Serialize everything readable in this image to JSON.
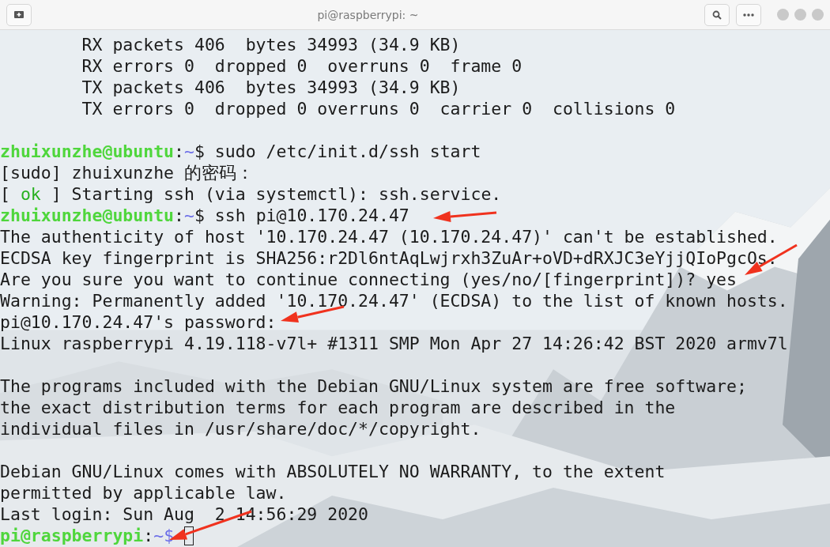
{
  "window": {
    "title": "pi@raspberrypi: ~"
  },
  "terminal": {
    "lines": [
      {
        "kind": "text",
        "segments": [
          {
            "kind": "plain",
            "text": "        RX packets 406  bytes 34993 (34.9 KB)"
          }
        ]
      },
      {
        "kind": "text",
        "segments": [
          {
            "kind": "plain",
            "text": "        RX errors 0  dropped 0  overruns 0  frame 0"
          }
        ]
      },
      {
        "kind": "text",
        "segments": [
          {
            "kind": "plain",
            "text": "        TX packets 406  bytes 34993 (34.9 KB)"
          }
        ]
      },
      {
        "kind": "text",
        "segments": [
          {
            "kind": "plain",
            "text": "        TX errors 0  dropped 0 overruns 0  carrier 0  collisions 0"
          }
        ]
      },
      {
        "kind": "blank"
      },
      {
        "kind": "text",
        "segments": [
          {
            "kind": "user",
            "text": "zhuixunzhe@ubuntu"
          },
          {
            "kind": "plain",
            "text": ":"
          },
          {
            "kind": "path",
            "text": "~"
          },
          {
            "kind": "plain",
            "text": "$ sudo /etc/init.d/ssh start"
          }
        ]
      },
      {
        "kind": "text",
        "segments": [
          {
            "kind": "plain",
            "text": "[sudo] zhuixunzhe 的密码："
          }
        ]
      },
      {
        "kind": "text",
        "segments": [
          {
            "kind": "plain",
            "text": "[ "
          },
          {
            "kind": "ok",
            "text": "ok"
          },
          {
            "kind": "plain",
            "text": " ] Starting ssh (via systemctl): ssh.service."
          }
        ]
      },
      {
        "kind": "text",
        "segments": [
          {
            "kind": "user",
            "text": "zhuixunzhe@ubuntu"
          },
          {
            "kind": "plain",
            "text": ":"
          },
          {
            "kind": "path",
            "text": "~"
          },
          {
            "kind": "plain",
            "text": "$ ssh pi@10.170.24.47"
          }
        ]
      },
      {
        "kind": "text",
        "segments": [
          {
            "kind": "plain",
            "text": "The authenticity of host '10.170.24.47 (10.170.24.47)' can't be established."
          }
        ]
      },
      {
        "kind": "text",
        "segments": [
          {
            "kind": "plain",
            "text": "ECDSA key fingerprint is SHA256:r2Dl6ntAqLwjrxh3ZuAr+oVD+dRXJC3eYjjQIoPgcOs."
          }
        ]
      },
      {
        "kind": "text",
        "segments": [
          {
            "kind": "plain",
            "text": "Are you sure you want to continue connecting (yes/no/[fingerprint])? yes"
          }
        ]
      },
      {
        "kind": "text",
        "segments": [
          {
            "kind": "plain",
            "text": "Warning: Permanently added '10.170.24.47' (ECDSA) to the list of known hosts."
          }
        ]
      },
      {
        "kind": "text",
        "segments": [
          {
            "kind": "plain",
            "text": "pi@10.170.24.47's password:"
          }
        ]
      },
      {
        "kind": "text",
        "segments": [
          {
            "kind": "plain",
            "text": "Linux raspberrypi 4.19.118-v7l+ #1311 SMP Mon Apr 27 14:26:42 BST 2020 armv7l"
          }
        ]
      },
      {
        "kind": "blank"
      },
      {
        "kind": "text",
        "segments": [
          {
            "kind": "plain",
            "text": "The programs included with the Debian GNU/Linux system are free software;"
          }
        ]
      },
      {
        "kind": "text",
        "segments": [
          {
            "kind": "plain",
            "text": "the exact distribution terms for each program are described in the"
          }
        ]
      },
      {
        "kind": "text",
        "segments": [
          {
            "kind": "plain",
            "text": "individual files in /usr/share/doc/*/copyright."
          }
        ]
      },
      {
        "kind": "blank"
      },
      {
        "kind": "text",
        "segments": [
          {
            "kind": "plain",
            "text": "Debian GNU/Linux comes with ABSOLUTELY NO WARRANTY, to the extent"
          }
        ]
      },
      {
        "kind": "text",
        "segments": [
          {
            "kind": "plain",
            "text": "permitted by applicable law."
          }
        ]
      },
      {
        "kind": "text",
        "segments": [
          {
            "kind": "plain",
            "text": "Last login: Sun Aug  2 14:56:29 2020"
          }
        ]
      },
      {
        "kind": "text",
        "cursor": true,
        "segments": [
          {
            "kind": "user",
            "text": "pi@raspberrypi"
          },
          {
            "kind": "plain",
            "text": ":"
          },
          {
            "kind": "path",
            "text": "~"
          },
          {
            "kind": "path",
            "text": "$ "
          }
        ]
      }
    ]
  }
}
